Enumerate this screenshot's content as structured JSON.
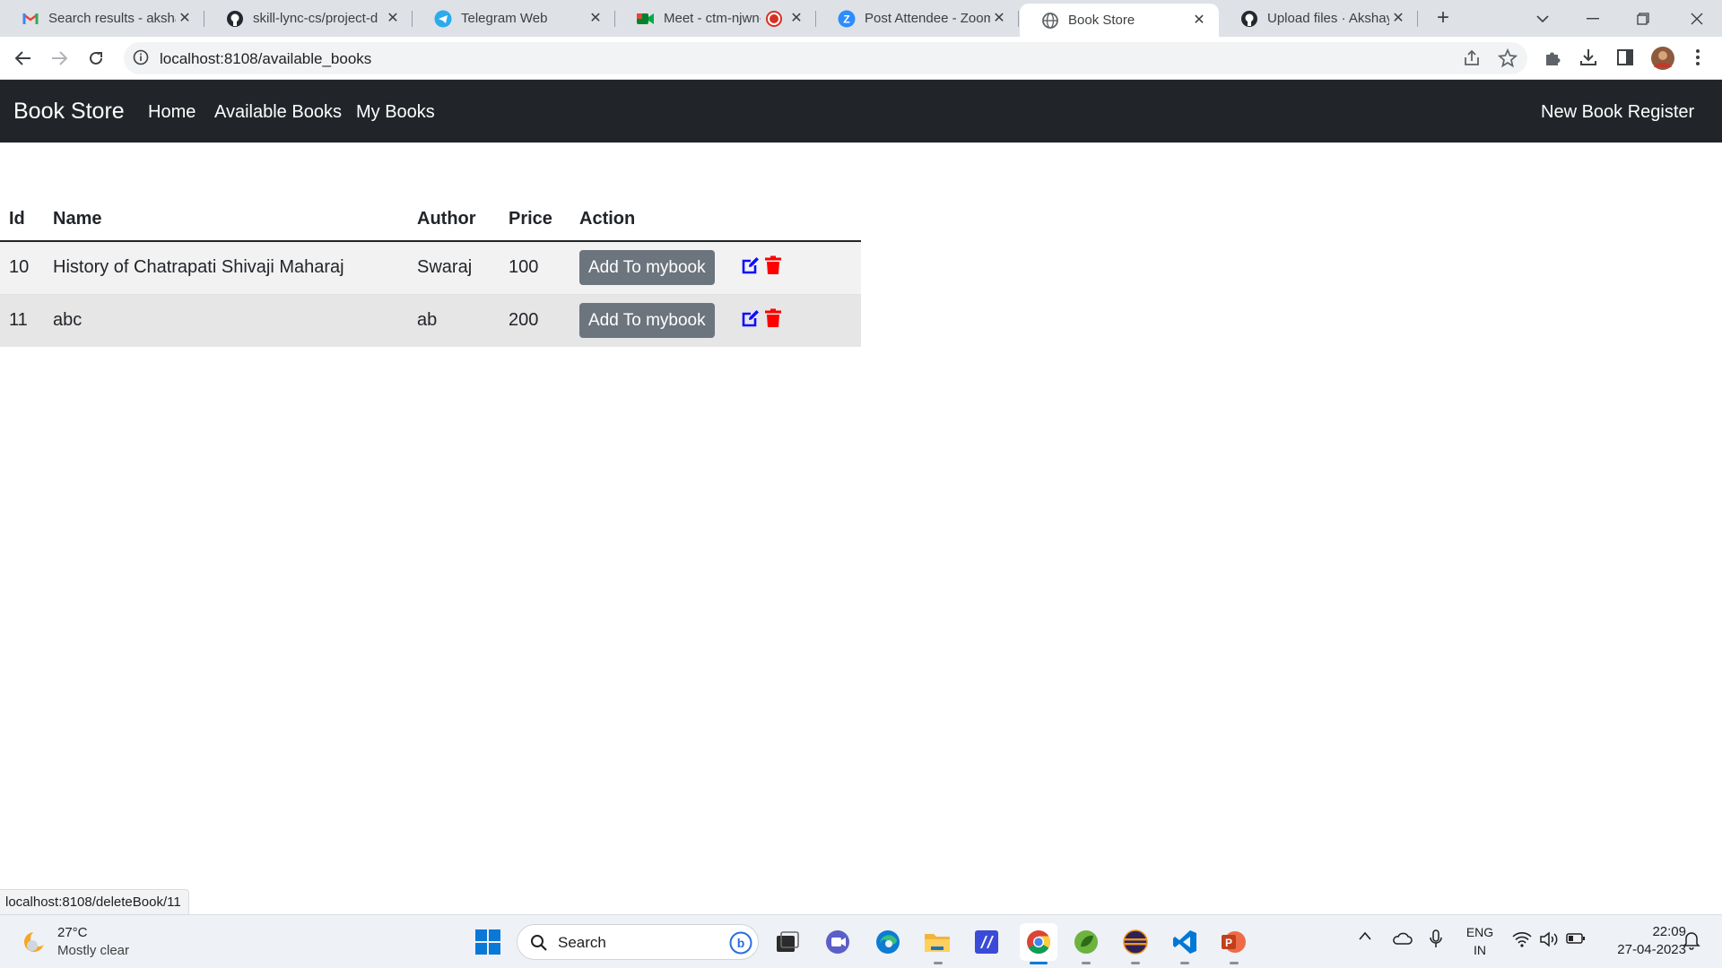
{
  "browser": {
    "tabs": [
      {
        "title": "Search results - aksha",
        "icon": "gmail-icon"
      },
      {
        "title": "skill-lync-cs/project-d",
        "icon": "github-icon"
      },
      {
        "title": "Telegram Web",
        "icon": "telegram-icon"
      },
      {
        "title": "Meet - ctm-njwn-",
        "icon": "google-meet-icon"
      },
      {
        "title": "Post Attendee - Zoom",
        "icon": "zoom-icon"
      },
      {
        "title": "Book Store",
        "icon": "globe-icon"
      },
      {
        "title": "Upload files · Akshay-",
        "icon": "github-icon"
      }
    ],
    "active_tab": "Book Store",
    "url": "localhost:8108/available_books",
    "status_url": "localhost:8108/deleteBook/11"
  },
  "navbar": {
    "brand": "Book Store",
    "links": [
      "Home",
      "Available Books",
      "My Books"
    ],
    "right_link": "New Book Register"
  },
  "table": {
    "headers": [
      "Id",
      "Name",
      "Author",
      "Price",
      "Action"
    ],
    "rows": [
      {
        "id": "10",
        "name": "History of Chatrapati Shivaji Maharaj",
        "author": "Swaraj",
        "price": "100",
        "action": "Add To mybook"
      },
      {
        "id": "11",
        "name": "abc",
        "author": "ab",
        "price": "200",
        "action": "Add To mybook"
      }
    ],
    "edit_icon_color": "#0d0dff",
    "delete_icon_color": "#ff0000"
  },
  "taskbar": {
    "weather_temp": "27°C",
    "weather_desc": "Mostly clear",
    "search_label": "Search",
    "lang_line1": "ENG",
    "lang_line2": "IN",
    "time": "22:09",
    "date": "27-04-2023"
  },
  "colors": {
    "navbar_bg": "#212529",
    "button_bg": "#6c757d",
    "tabstrip_bg": "#dee1e6"
  }
}
